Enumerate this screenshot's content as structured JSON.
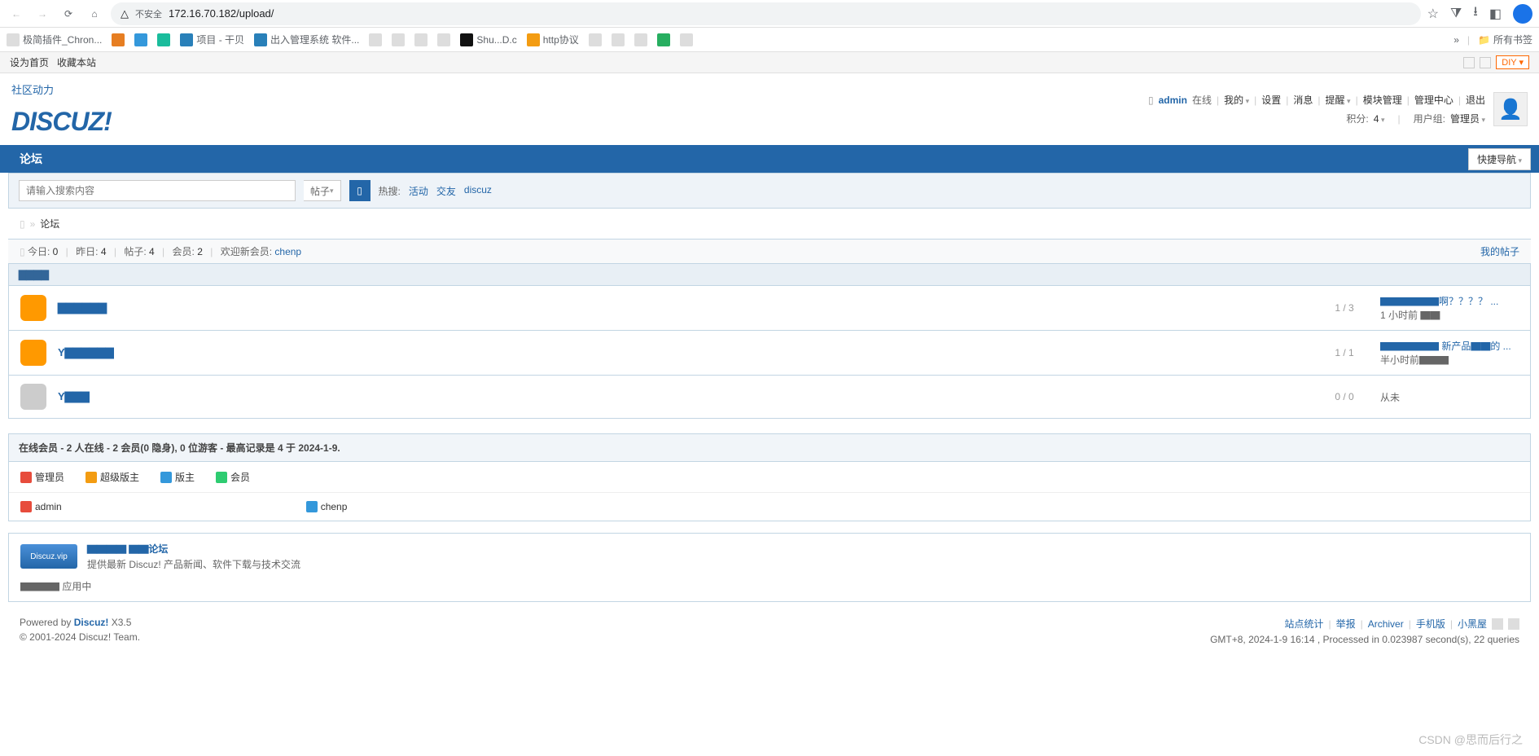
{
  "browser": {
    "url": "172.16.70.182/upload/",
    "insecure": "不安全",
    "bookmarks": [
      "极简插件_Chron...",
      "项目 - 干贝",
      "出入管理系统 软件...",
      "Shu...D.c",
      "http协议",
      "所有书签"
    ]
  },
  "topbar": {
    "set_home": "设为首页",
    "favorite": "收藏本站",
    "diy": "DIY"
  },
  "header": {
    "logo_main": "DISCUZ!",
    "logo_sub": "社区动力",
    "user": {
      "name": "admin",
      "online": "在线",
      "my": "我的",
      "settings": "设置",
      "messages": "消息",
      "reminders": "提醒",
      "module_mgmt": "模块管理",
      "admin_center": "管理中心",
      "logout": "退出",
      "points_label": "积分:",
      "points_value": "4",
      "group_label": "用户组:",
      "group_value": "管理员"
    }
  },
  "nav": {
    "forum": "论坛",
    "quick_nav": "快捷导航"
  },
  "search": {
    "placeholder": "请输入搜索内容",
    "type": "帖子",
    "hot_label": "热搜:",
    "hot": [
      "活动",
      "交友",
      "discuz"
    ]
  },
  "breadcrumb": {
    "forum": "论坛"
  },
  "stats": {
    "today_label": "今日:",
    "today": "0",
    "yesterday_label": "昨日:",
    "yesterday": "4",
    "posts_label": "帖子:",
    "posts": "4",
    "members_label": "会员:",
    "members": "2",
    "welcome_label": "欢迎新会员:",
    "welcome_user": "chenp",
    "my_posts": "我的帖子"
  },
  "category": {
    "name": "▇▇▇▇"
  },
  "forums": [
    {
      "name": "▇▇▇▇▇▇",
      "stats": "1 / 3",
      "last_title": "▇▇▇▇▇▇啊？？？？ ...",
      "last_time": "1 小时前 ▇▇",
      "icon": "orange"
    },
    {
      "name": "Y▇▇▇▇▇▇",
      "stats": "1 / 1",
      "last_title": "▇▇▇▇▇▇ 新产品▇▇的 ...",
      "last_time": "半小时前▇▇▇",
      "icon": "orange"
    },
    {
      "name": "Y▇▇▇",
      "stats": "0 / 0",
      "last_title": "",
      "last_time": "从未",
      "icon": "gray"
    }
  ],
  "online": {
    "header": "在线会员 - 2 人在线 - 2 会员(0 隐身), 0 位游客 - 最高记录是 4 于 2024-1-9.",
    "legend": {
      "admin": "管理员",
      "supermod": "超级版主",
      "mod": "版主",
      "member": "会员"
    },
    "users": [
      {
        "name": "admin",
        "color": "red"
      },
      {
        "name": "chenp",
        "color": "blue"
      }
    ]
  },
  "promo": {
    "badge": "Discuz.vip",
    "title": "▇▇▇▇ ▇▇论坛",
    "desc": "提供最新 Discuz! 产品新闻、软件下载与技术交流",
    "footer": "▇▇▇▇ 应用中"
  },
  "footer": {
    "powered": "Powered by",
    "product": "Discuz!",
    "version": "X3.5",
    "copyright": "© 2001-2024 Discuz! Team.",
    "links": [
      "站点统计",
      "举报",
      "Archiver",
      "手机版",
      "小黑屋"
    ],
    "gmt": "GMT+8, 2024-1-9 16:14 , Processed in 0.023987 second(s), 22 queries"
  },
  "watermark": "CSDN @思而后行之"
}
